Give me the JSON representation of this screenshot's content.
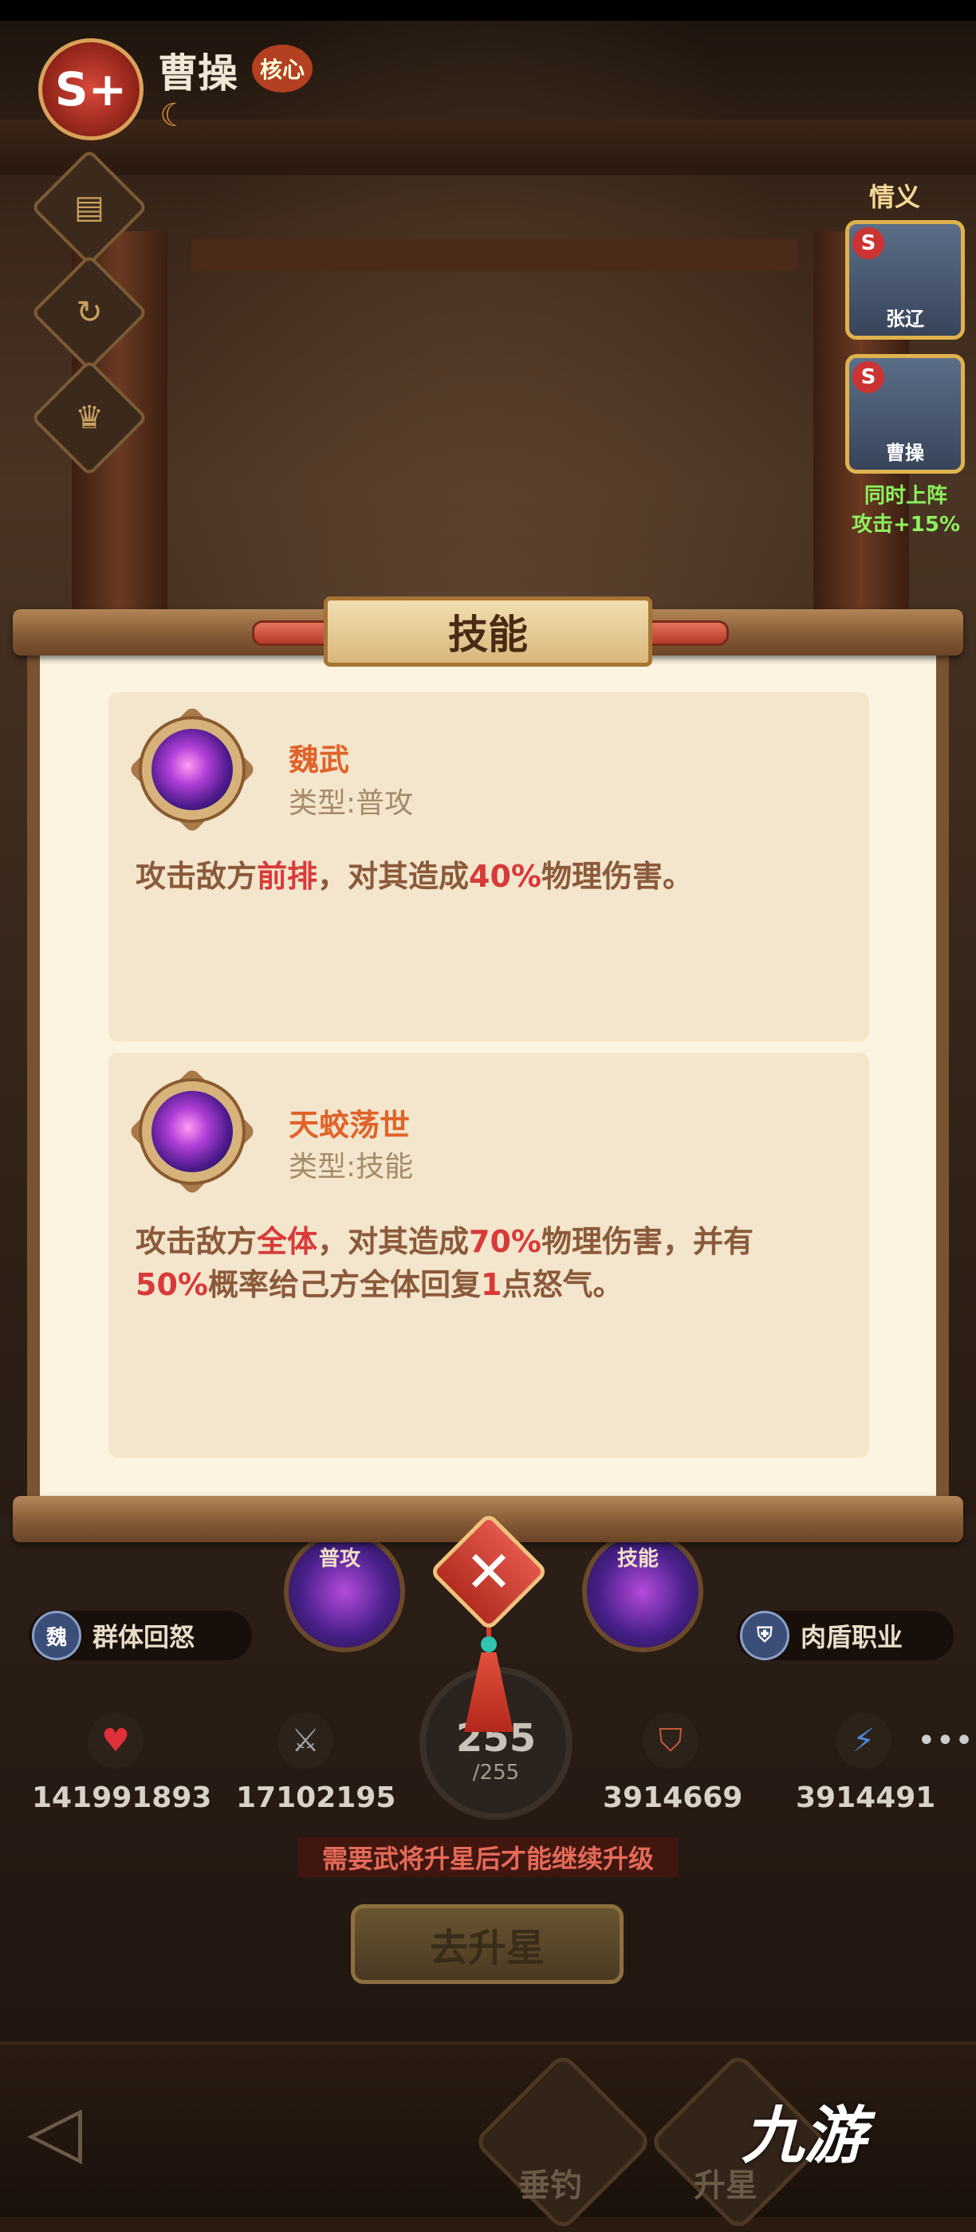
{
  "hero": {
    "rank": "S+",
    "name": "曹操",
    "core_tag": "核心"
  },
  "bond": {
    "title": "情义",
    "members": [
      {
        "name": "张辽"
      },
      {
        "name": "曹操"
      }
    ],
    "note_line1": "同时上阵",
    "note_line2": "攻击+15%"
  },
  "skill_panel": {
    "title": "技能",
    "skills": [
      {
        "name": "魏武",
        "type": "类型:普攻",
        "desc": [
          {
            "t": "攻击敌方",
            "hl": false
          },
          {
            "t": "前排",
            "hl": true
          },
          {
            "t": "，对其造成",
            "hl": false
          },
          {
            "t": "40%",
            "hl": true
          },
          {
            "t": "物理伤害。",
            "hl": false
          }
        ]
      },
      {
        "name": "天蛟荡世",
        "type": "类型:技能",
        "desc": [
          {
            "t": "攻击敌方",
            "hl": false
          },
          {
            "t": "全体",
            "hl": true
          },
          {
            "t": "，对其造成",
            "hl": false
          },
          {
            "t": "70%",
            "hl": true
          },
          {
            "t": "物理伤害，并有",
            "hl": false
          },
          {
            "t": "50%",
            "hl": true
          },
          {
            "t": "概率给己方全体回复",
            "hl": false
          },
          {
            "t": "1",
            "hl": true
          },
          {
            "t": "点怒气。",
            "hl": false
          }
        ]
      }
    ]
  },
  "hud": {
    "skill_orbs": [
      {
        "label": "普攻"
      },
      {
        "label": "技能"
      }
    ],
    "faction_pill": {
      "icon": "魏",
      "label": "群体回怒"
    },
    "role_pill": {
      "label": "肉盾职业"
    },
    "stats": [
      {
        "icon": "heart-icon",
        "value": "141991893"
      },
      {
        "icon": "swords-icon",
        "value": "17102195"
      },
      {
        "icon": "shield-icon",
        "value": "3914669"
      },
      {
        "icon": "shield-bolt-icon",
        "value": "3914491"
      }
    ],
    "level": {
      "current": "255",
      "max": "/255"
    },
    "warning": "需要武将升星后才能继续升级",
    "star_button": "去升星"
  },
  "bottom_nav": {
    "items": [
      {
        "label": "垂钓"
      },
      {
        "label": "升星"
      }
    ]
  },
  "watermark": "九游",
  "colors": {
    "accent_red": "#d83a3a",
    "skill_name": "#e0632a",
    "paper": "#fcf3e0",
    "bond_note": "#8df25e"
  }
}
